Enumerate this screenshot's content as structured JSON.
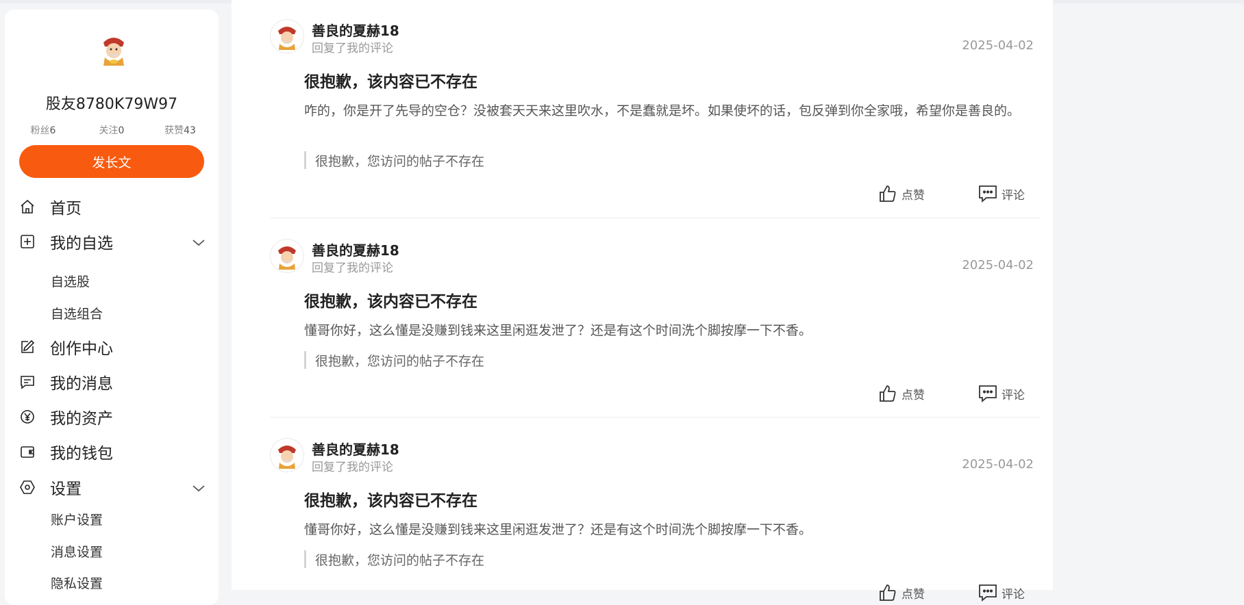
{
  "profile": {
    "name": "股友8780K79W97",
    "stats": [
      {
        "label": "粉丝",
        "value": "6"
      },
      {
        "label": "关注",
        "value": "0"
      },
      {
        "label": "获赞",
        "value": "43"
      }
    ],
    "post_button": "发长文"
  },
  "nav": {
    "home": "首页",
    "watchlist": "我的自选",
    "watchlist_sub": [
      "自选股",
      "自选组合"
    ],
    "creator": "创作中心",
    "messages": "我的消息",
    "assets": "我的资产",
    "wallet": "我的钱包",
    "settings": "设置",
    "settings_sub": [
      "账户设置",
      "消息设置",
      "隐私设置"
    ]
  },
  "comments": [
    {
      "user": "善良的夏赫18",
      "action": "回复了我的评论",
      "date": "2025-04-02",
      "title": "很抱歉，该内容已不存在",
      "body": "咋的，你是开了先导的空仓？没被套天天来这里吹水，不是蠢就是坏。如果使坏的话，包反弹到你全家哦，希望你是善良的。",
      "quote": "很抱歉，您访问的帖子不存在",
      "like_label": "点赞",
      "comment_label": "评论"
    },
    {
      "user": "善良的夏赫18",
      "action": "回复了我的评论",
      "date": "2025-04-02",
      "title": "很抱歉，该内容已不存在",
      "body": "懂哥你好，这么懂是没赚到钱来这里闲逛发泄了？还是有这个时间洗个脚按摩一下不香。",
      "quote": "很抱歉，您访问的帖子不存在",
      "like_label": "点赞",
      "comment_label": "评论"
    },
    {
      "user": "善良的夏赫18",
      "action": "回复了我的评论",
      "date": "2025-04-02",
      "title": "很抱歉，该内容已不存在",
      "body": "懂哥你好，这么懂是没赚到钱来这里闲逛发泄了？还是有这个时间洗个脚按摩一下不香。",
      "quote": "很抱歉，您访问的帖子不存在",
      "like_label": "点赞",
      "comment_label": "评论"
    }
  ],
  "colors": {
    "accent": "#f85a0f",
    "page_bg": "#f4f5f7"
  }
}
